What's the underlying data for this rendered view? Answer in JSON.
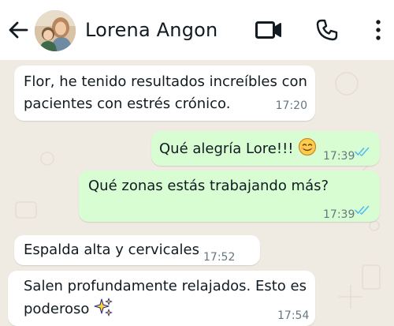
{
  "header": {
    "contact_name": "Lorena Angon",
    "icons": [
      "back-arrow-icon",
      "video-camera-icon",
      "phone-icon",
      "more-vertical-icon"
    ]
  },
  "colors": {
    "chat_background": "#efeae2",
    "incoming_bubble": "#ffffff",
    "outgoing_bubble": "#d9fdd3",
    "read_ticks": "#53bdeb",
    "timestamp": "#667781"
  },
  "messages": [
    {
      "direction": "incoming",
      "line1": "Flor, he tenido resultados increíbles con",
      "line2": "pacientes con estrés crónico.",
      "time": "17:20"
    },
    {
      "direction": "outgoing",
      "text": "Qué alegría Lore!!!",
      "emoji": "smiling-face-icon",
      "time": "17:39",
      "status": "read"
    },
    {
      "direction": "outgoing",
      "text": "Qué zonas estás trabajando más?",
      "time": "17:39",
      "status": "read"
    },
    {
      "direction": "incoming",
      "text": "Espalda alta y cervicales",
      "time": "17:52"
    },
    {
      "direction": "incoming",
      "line1": "Salen profundamente relajados. Esto es",
      "line2": "poderoso",
      "emoji": "sparkles-icon",
      "time": "17:54"
    }
  ]
}
